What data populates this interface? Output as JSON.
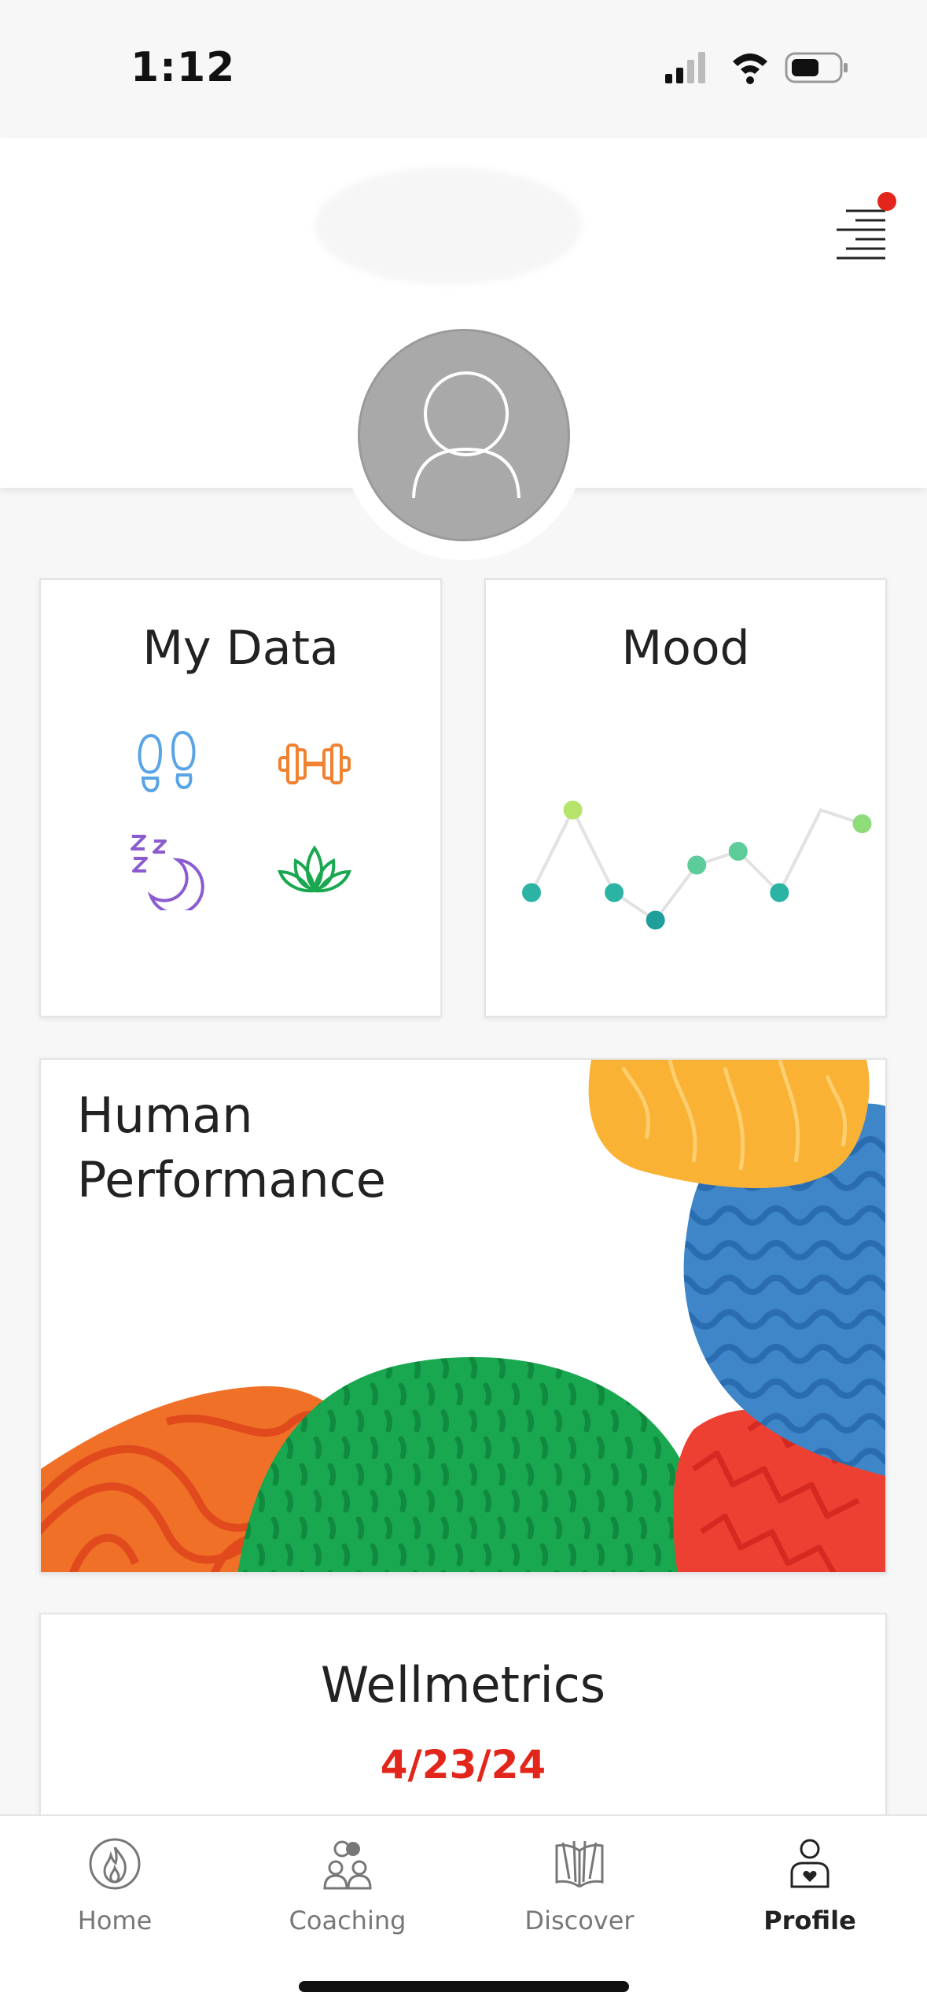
{
  "status_bar": {
    "time": "1:12",
    "icons": [
      "signal-icon",
      "wifi-icon",
      "battery-icon"
    ]
  },
  "header": {
    "menu_icon": "menu-lines-icon",
    "has_notification": true,
    "notification_color": "#e3261b"
  },
  "profile": {
    "avatar_icon": "user-placeholder-icon"
  },
  "cards": {
    "my_data": {
      "title": "My Data",
      "icons": [
        "footsteps-icon",
        "dumbbell-icon",
        "sleep-moon-icon",
        "lotus-icon"
      ]
    },
    "mood": {
      "title": "Mood"
    },
    "human_performance": {
      "title": "Human Performance"
    },
    "wellmetrics": {
      "title": "Wellmetrics",
      "date": "4/23/24"
    }
  },
  "chart_data": {
    "type": "line",
    "x": [
      1,
      2,
      3,
      4,
      5,
      6,
      7,
      8,
      9,
      10
    ],
    "values": [
      2,
      5,
      2,
      1,
      3,
      3.5,
      2,
      5,
      4.5,
      null
    ],
    "point_colors": [
      "#2bb3a3",
      "#b6e36a",
      "#2bb3a3",
      "#1f9e9a",
      "#5ccd9a",
      "#5ccd9a",
      "#2bb3a3",
      null,
      "#8fdc7a",
      null
    ],
    "line_color": "#e2e2e2",
    "title": "",
    "xlabel": "",
    "ylabel": ""
  },
  "tabbar": {
    "tabs": [
      {
        "label": "Home",
        "icon": "flame-icon",
        "active": false
      },
      {
        "label": "Coaching",
        "icon": "people-icon",
        "active": false
      },
      {
        "label": "Discover",
        "icon": "book-icon",
        "active": false
      },
      {
        "label": "Profile",
        "icon": "profile-heart-icon",
        "active": true
      }
    ]
  },
  "colors": {
    "accent_red": "#e3261b",
    "steps_blue": "#5aa4e6",
    "fitness_orange": "#f08232",
    "sleep_purple": "#8a5cd0",
    "mindful_green": "#19a84f"
  }
}
